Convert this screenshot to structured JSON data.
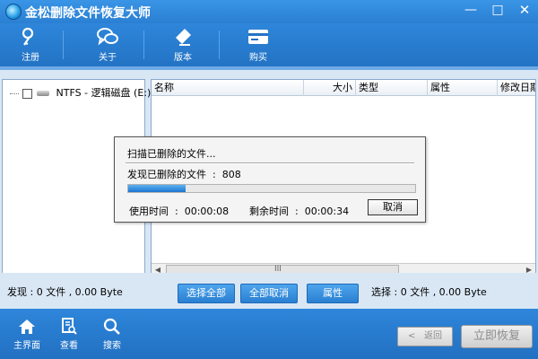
{
  "app": {
    "title": "金松删除文件恢复大师"
  },
  "window_controls": {
    "minimize": "—",
    "maximize": "□",
    "close": "✕"
  },
  "toolbar": {
    "items": [
      {
        "icon": "key-icon",
        "label": "注册"
      },
      {
        "icon": "chat-bubbles-icon",
        "label": "关于"
      },
      {
        "icon": "eraser-icon",
        "label": "版本"
      },
      {
        "icon": "card-icon",
        "label": "购买"
      }
    ]
  },
  "tree": {
    "drive_label": "NTFS - 逻辑磁盘 (E:)"
  },
  "list": {
    "columns": [
      "名称",
      "大小",
      "类型",
      "属性",
      "修改日期"
    ],
    "scroll_grip": "III"
  },
  "dialog": {
    "scanning": "扫描已删除的文件...",
    "found_label": "发现已删除的文件",
    "found_sep": ":",
    "found_count": "808",
    "progress_fraction": 0.2,
    "used_label": "使用时间",
    "used_sep": ":",
    "used_time": "00:00:08",
    "remaining_label": "剩余时间",
    "remaining_sep": ":",
    "remaining_time": "00:00:34",
    "cancel": "取消"
  },
  "status": {
    "found": "发现 : 0 文件 , 0.00 Byte",
    "selected": "选择 : 0 文件 , 0.00 Byte"
  },
  "actions": {
    "select_all": "选择全部",
    "cancel_all": "全部取消",
    "properties": "属性"
  },
  "bottom_nav": {
    "items": [
      {
        "icon": "home-icon",
        "label": "主界面"
      },
      {
        "icon": "document-search-icon",
        "label": "查看"
      },
      {
        "icon": "magnifier-icon",
        "label": "搜索"
      }
    ]
  },
  "buttons": {
    "back": "返回",
    "back_arrow": "<",
    "recover": "立即恢复"
  }
}
